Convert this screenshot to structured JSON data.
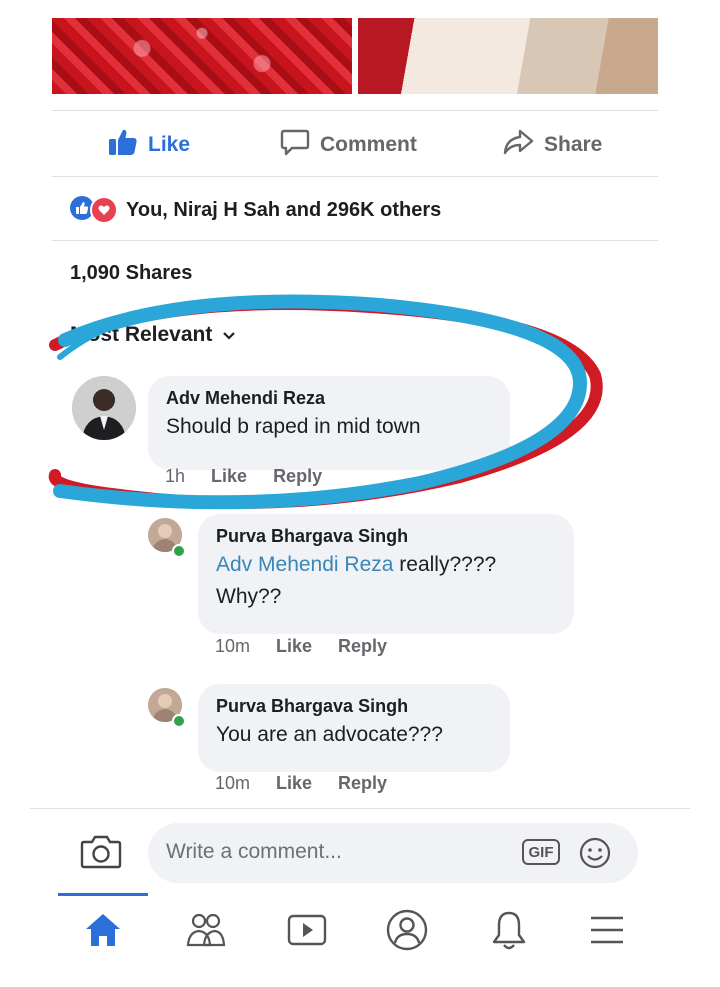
{
  "post": {
    "actions": {
      "like": "Like",
      "comment": "Comment",
      "share": "Share"
    },
    "reactions_text": "You, Niraj H Sah and 296K others",
    "shares_text": "1,090 Shares",
    "sort_label": "Most Relevant"
  },
  "comments": [
    {
      "author": "Adv Mehendi Reza",
      "text": "Should b raped in mid town",
      "time": "1h",
      "like": "Like",
      "reply": "Reply"
    }
  ],
  "replies": [
    {
      "author": "Purva Bhargava Singh",
      "mention": "Adv Mehendi Reza",
      "text_after_mention": " really????",
      "text_line2": "Why??",
      "time": "10m",
      "like": "Like",
      "reply": "Reply"
    },
    {
      "author": "Purva Bhargava Singh",
      "text": "You are an advocate???",
      "time": "10m",
      "like": "Like",
      "reply": "Reply"
    }
  ],
  "composer": {
    "placeholder": "Write a comment...",
    "gif_label": "GIF"
  },
  "colors": {
    "accent": "#2d6fd8",
    "circle_blue": "#2aa6d8",
    "circle_red": "#d01a24",
    "bubble": "#f0f2f5"
  },
  "icons": {
    "like": "thumbs-up-icon",
    "comment": "speech-bubble-icon",
    "share": "share-arrow-icon",
    "camera": "camera-icon",
    "emoji": "smiley-icon",
    "nav": [
      "home-icon",
      "friends-icon",
      "watch-icon",
      "profile-icon",
      "bell-icon",
      "menu-icon"
    ]
  }
}
